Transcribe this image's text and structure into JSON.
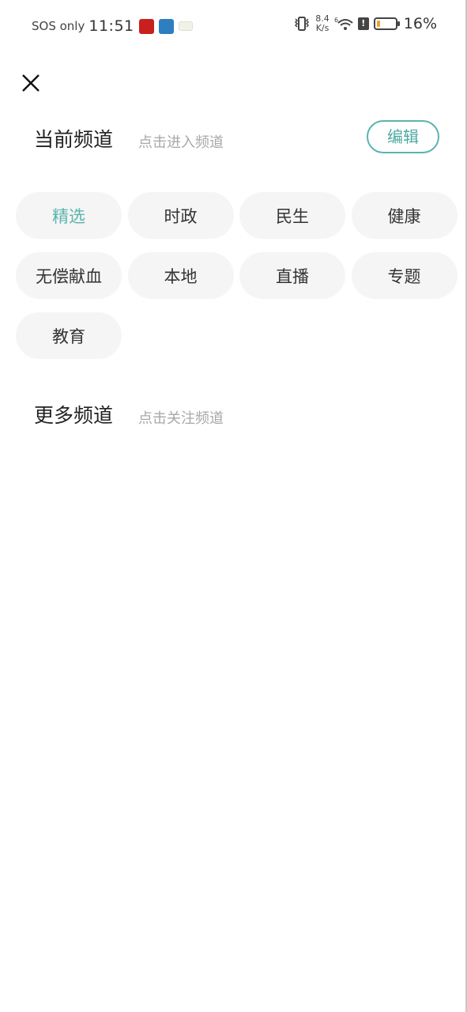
{
  "status_bar": {
    "carrier": "SOS only",
    "time": "11:51",
    "notification_icons": [
      "news-app-icon",
      "translate-app-icon",
      "green-app-icon"
    ],
    "net_speed_value": "8.4",
    "net_speed_unit": "K/s",
    "wifi_label": "6",
    "battery_percent": "16%",
    "battery_level": 0.16,
    "battery_color": "#f0a52a"
  },
  "header": {
    "close_icon": "close-icon"
  },
  "current_channels": {
    "title": "当前频道",
    "hint": "点击进入频道",
    "edit_label": "编辑",
    "accent_color": "#5ab5ad",
    "items": [
      {
        "label": "精选",
        "active": true
      },
      {
        "label": "时政",
        "active": false
      },
      {
        "label": "民生",
        "active": false
      },
      {
        "label": "健康",
        "active": false
      },
      {
        "label": "无偿献血",
        "active": false
      },
      {
        "label": "本地",
        "active": false
      },
      {
        "label": "直播",
        "active": false
      },
      {
        "label": "专题",
        "active": false
      },
      {
        "label": "教育",
        "active": false
      }
    ]
  },
  "more_channels": {
    "title": "更多频道",
    "hint": "点击关注频道",
    "items": []
  }
}
